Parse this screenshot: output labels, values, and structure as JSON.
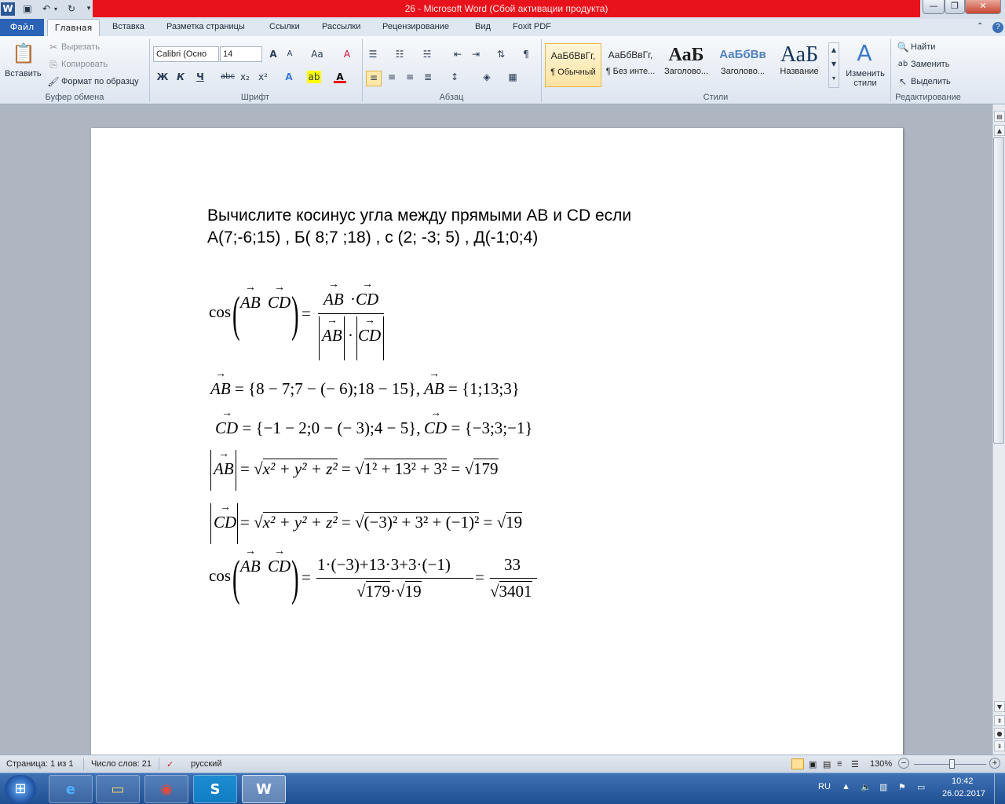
{
  "titlebar": {
    "title": "26  -  Microsoft Word (Сбой активации продукта)",
    "word_icon": "W",
    "minimize": "—",
    "maximize": "❐",
    "close": "✕"
  },
  "tabs": {
    "file": "Файл",
    "items": [
      "Главная",
      "Вставка",
      "Разметка страницы",
      "Ссылки",
      "Рассылки",
      "Рецензирование",
      "Вид",
      "Foxit PDF"
    ]
  },
  "ribbon": {
    "clipboard": {
      "paste": "Вставить",
      "cut": "Вырезать",
      "copy": "Копировать",
      "format_painter": "Формат по образцу",
      "label": "Буфер обмена"
    },
    "font": {
      "family": "Calibri (Осно",
      "size": "14",
      "label": "Шрифт",
      "bold": "Ж",
      "italic": "К",
      "underline": "Ч",
      "strike": "abc",
      "sub": "x₂",
      "sup": "x²",
      "grow": "A",
      "shrink": "A",
      "case": "Aa",
      "clear": "A",
      "highlight": "ab",
      "color": "A"
    },
    "paragraph": {
      "label": "Абзац",
      "pilcrow": "¶"
    },
    "styles": {
      "label": "Стили",
      "items": [
        {
          "sample": "АаБбВвГг,",
          "name": "¶ Обычный"
        },
        {
          "sample": "АаБбВвГг,",
          "name": "¶ Без инте..."
        },
        {
          "sample": "АаБ",
          "name": "Заголово..."
        },
        {
          "sample": "АаБбВв",
          "name": "Заголово..."
        },
        {
          "sample": "АаБ",
          "name": "Название"
        }
      ],
      "change_label": "Изменить стили"
    },
    "editing": {
      "label": "Редактирование",
      "find": "Найти",
      "replace": "Заменить",
      "select": "Выделить"
    }
  },
  "document": {
    "line1": "Вычислите косинус угла между прямыми AB и CD если",
    "line2": "А(7;-6;15) , Б( 8;7 ;18) , с (2; -3; 5) , Д(-1;0;4)",
    "formulas": {
      "cos_lhs": "cos",
      "ab": "AB",
      "cd": "CD",
      "dot": "·",
      "eq": "=",
      "f2_lhs": "AB",
      "f2_rhs": "= {8 − 7;7 − (− 6);18 − 15},",
      "f2_res_lhs": "AB",
      "f2_res": "= {1;13;3}",
      "f3_lhs": "CD",
      "f3_rhs": "= {−1 − 2;0 − (− 3);4 − 5},",
      "f3_res_lhs": "CD",
      "f3_res": "= {−3;3;−1}",
      "f4_lhs": "AB",
      "f4_mid": "x² + y² + z²",
      "f4_nums": "1² + 13² + 3²",
      "f4_res": "179",
      "f5_lhs": "CD",
      "f5_mid": "x² + y² + z²",
      "f5_nums": "(−3)² + 3² + (−1)²",
      "f5_res": "19",
      "f6_num": "1·(−3)+13·3+3·(−1)",
      "f6_den_a": "179",
      "f6_den_b": "19",
      "f6_res_num": "33",
      "f6_res_den": "3401"
    }
  },
  "statusbar": {
    "page": "Страница: 1 из 1",
    "words": "Число слов: 21",
    "lang": "русский",
    "zoom": "130%",
    "zoom_minus": "−",
    "zoom_plus": "+"
  },
  "taskbar": {
    "lang": "RU",
    "time": "10:42",
    "date": "26.02.2017",
    "word_btn": "W"
  },
  "colors": {
    "titlebar_red": "#e8121c",
    "file_tab": "#2a62b6",
    "taskbar": "#2a5da0"
  }
}
